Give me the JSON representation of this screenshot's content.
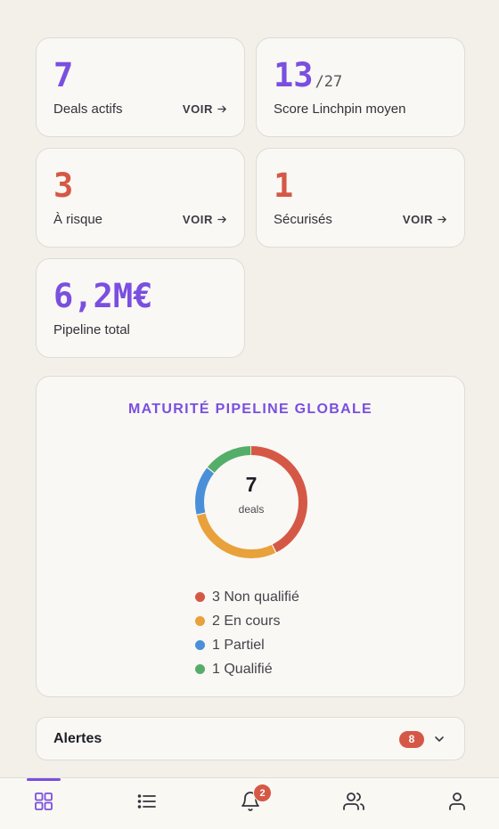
{
  "stats": [
    {
      "value": "7",
      "label": "Deals actifs",
      "link": "VOIR",
      "color": "#7a4fe0"
    },
    {
      "value": "13",
      "suffix": "/27",
      "label": "Score Linchpin moyen",
      "color": "#7a4fe0"
    },
    {
      "value": "3",
      "label": "À risque",
      "link": "VOIR",
      "color": "#d55846"
    },
    {
      "value": "1",
      "label": "Sécurisés",
      "link": "VOIR",
      "color": "#d55846"
    },
    {
      "value": "6,2M€",
      "label": "Pipeline total",
      "color": "#7a4fe0"
    }
  ],
  "maturity": {
    "title": "MATURITÉ PIPELINE GLOBALE",
    "center_value": "7",
    "center_label": "deals",
    "legend": [
      {
        "text": "3 Non qualifié",
        "count": 3,
        "color": "#d55846"
      },
      {
        "text": "2 En cours",
        "count": 2,
        "color": "#e8a13b"
      },
      {
        "text": "1 Partiel",
        "count": 1,
        "color": "#4a90d9"
      },
      {
        "text": "1 Qualifié",
        "count": 1,
        "color": "#55ad6a"
      }
    ]
  },
  "alerts": {
    "title": "Alertes",
    "count": "8"
  },
  "nav": {
    "items": [
      "dashboard-icon",
      "list-icon",
      "bell-icon",
      "users-icon",
      "profile-icon"
    ],
    "active": "dashboard-icon",
    "notifications_badge": "2",
    "accent": "#7a4fe0"
  }
}
